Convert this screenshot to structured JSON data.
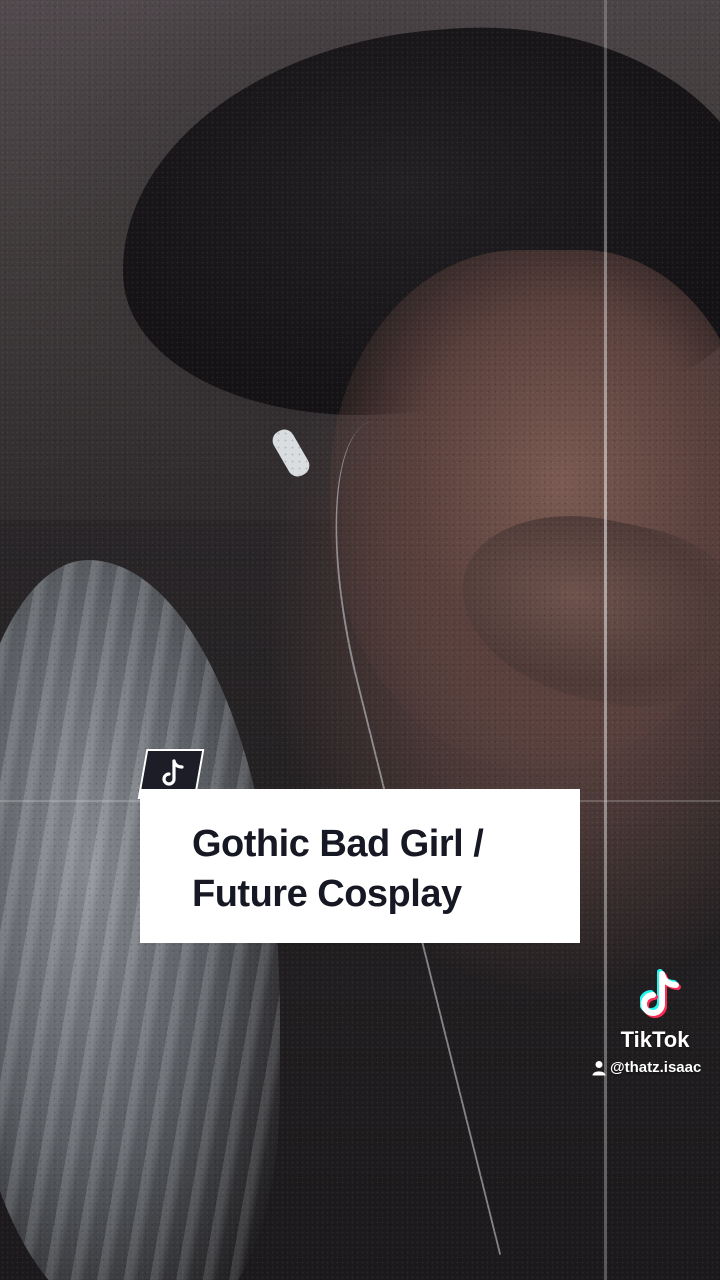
{
  "video": {
    "description": "",
    "colors": {
      "caption_text": "#161823",
      "caption_background": "#ffffff",
      "badge_background": "#1c1d26",
      "tiktok_cyan": "#25f4ee",
      "tiktok_red": "#fe2c55"
    }
  },
  "caption": {
    "line1": "Gothic Bad Girl /",
    "line2": "Future Cosplay",
    "badge_icon": "tiktok-note-icon"
  },
  "watermark": {
    "logo_icon": "tiktok-logo-icon",
    "brand": "TikTok",
    "user_icon": "person-icon",
    "username": "@thatz.isaac"
  }
}
